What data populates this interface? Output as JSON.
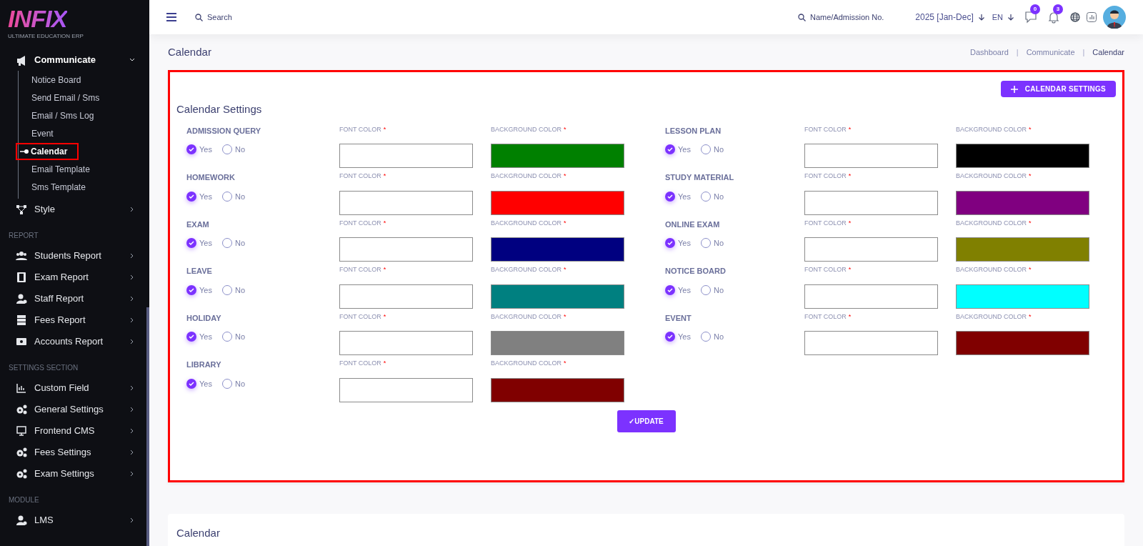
{
  "sidebar": {
    "logo": {
      "name": "INFIX",
      "tagline": "ULTIMATE EDUCATION ERP"
    },
    "sections": [
      {
        "items": [
          {
            "label": "Communicate",
            "expanded": true,
            "children": [
              {
                "label": "Notice Board",
                "selected": false
              },
              {
                "label": "Send Email / Sms",
                "selected": false
              },
              {
                "label": "Email / Sms Log",
                "selected": false
              },
              {
                "label": "Event",
                "selected": false
              },
              {
                "label": "Calendar",
                "selected": true
              },
              {
                "label": "Email Template",
                "selected": false
              },
              {
                "label": "Sms Template",
                "selected": false
              }
            ]
          },
          {
            "label": "Style",
            "expanded": false
          }
        ]
      },
      {
        "heading": "REPORT",
        "items": [
          {
            "label": "Students Report",
            "expanded": false
          },
          {
            "label": "Exam Report",
            "expanded": false
          },
          {
            "label": "Staff Report",
            "expanded": false
          },
          {
            "label": "Fees Report",
            "expanded": false
          },
          {
            "label": "Accounts Report",
            "expanded": false
          }
        ]
      },
      {
        "heading": "SETTINGS SECTION",
        "items": [
          {
            "label": "Custom Field",
            "expanded": false
          },
          {
            "label": "General Settings",
            "expanded": false
          },
          {
            "label": "Frontend CMS",
            "expanded": false
          },
          {
            "label": "Fees Settings",
            "expanded": false
          },
          {
            "label": "Exam Settings",
            "expanded": false
          }
        ]
      },
      {
        "heading": "MODULE",
        "items": [
          {
            "label": "LMS",
            "expanded": false
          }
        ]
      }
    ]
  },
  "header": {
    "search": "Search",
    "student_search": "Name/Admission No.",
    "session": "2025 [Jan-Dec]",
    "language": "EN",
    "message_count": "0",
    "notification_count": "3"
  },
  "page": {
    "title": "Calendar",
    "breadcrumbs": [
      "Dashboard",
      "Communicate",
      "Calendar"
    ],
    "breadcrumb_separators": [
      "|",
      "|"
    ]
  },
  "settings_card": {
    "add_button": "CALENDAR SETTINGS",
    "title": "Calendar Settings",
    "columns": [
      {
        "items": [
          {
            "name": "ADMISSION QUERY",
            "font_label": "FONT COLOR",
            "font_required": "*",
            "background_label": "BACKGROUND COLOR",
            "background_required": "*",
            "color": "#008000",
            "options": [
              {
                "label": "Yes",
                "selected": true
              },
              {
                "label": "No",
                "selected": false
              }
            ]
          },
          {
            "name": "HOMEWORK",
            "font_label": "FONT COLOR",
            "font_required": "*",
            "background_label": "BACKGROUND COLOR",
            "background_required": "*",
            "color": "#ff0000",
            "options": [
              {
                "label": "Yes",
                "selected": true
              },
              {
                "label": "No",
                "selected": false
              }
            ]
          },
          {
            "name": "EXAM",
            "font_label": "FONT COLOR",
            "font_required": "*",
            "background_label": "BACKGROUND COLOR",
            "background_required": "*",
            "color": "#000080",
            "options": [
              {
                "label": "Yes",
                "selected": true
              },
              {
                "label": "No",
                "selected": false
              }
            ]
          },
          {
            "name": "LEAVE",
            "font_label": "FONT COLOR",
            "font_required": "*",
            "background_label": "BACKGROUND COLOR",
            "background_required": "*",
            "color": "#008080",
            "options": [
              {
                "label": "Yes",
                "selected": true
              },
              {
                "label": "No",
                "selected": false
              }
            ]
          },
          {
            "name": "HOLIDAY",
            "font_label": "FONT COLOR",
            "font_required": "*",
            "background_label": "BACKGROUND COLOR",
            "background_required": "*",
            "color": "#808080",
            "options": [
              {
                "label": "Yes",
                "selected": true
              },
              {
                "label": "No",
                "selected": false
              }
            ]
          },
          {
            "name": "LIBRARY",
            "font_label": "FONT COLOR",
            "font_required": "*",
            "background_label": "BACKGROUND COLOR",
            "background_required": "*",
            "color": "#800000",
            "options": [
              {
                "label": "Yes",
                "selected": true
              },
              {
                "label": "No",
                "selected": false
              }
            ]
          }
        ]
      },
      {
        "items": [
          {
            "name": "LESSON PLAN",
            "font_label": "FONT COLOR",
            "font_required": "*",
            "background_label": "BACKGROUND COLOR",
            "background_required": "*",
            "color": "#000000",
            "options": [
              {
                "label": "Yes",
                "selected": true
              },
              {
                "label": "No",
                "selected": false
              }
            ]
          },
          {
            "name": "STUDY MATERIAL",
            "font_label": "FONT COLOR",
            "font_required": "*",
            "background_label": "BACKGROUND COLOR",
            "background_required": "*",
            "color": "#800080",
            "options": [
              {
                "label": "Yes",
                "selected": true
              },
              {
                "label": "No",
                "selected": false
              }
            ]
          },
          {
            "name": "ONLINE EXAM",
            "font_label": "FONT COLOR",
            "font_required": "*",
            "background_label": "BACKGROUND COLOR",
            "background_required": "*",
            "color": "#808000",
            "options": [
              {
                "label": "Yes",
                "selected": true
              },
              {
                "label": "No",
                "selected": false
              }
            ]
          },
          {
            "name": "NOTICE BOARD",
            "font_label": "FONT COLOR",
            "font_required": "*",
            "background_label": "BACKGROUND COLOR",
            "background_required": "*",
            "color": "#00ffff",
            "options": [
              {
                "label": "Yes",
                "selected": true
              },
              {
                "label": "No",
                "selected": false
              }
            ]
          },
          {
            "name": "EVENT",
            "font_label": "FONT COLOR",
            "font_required": "*",
            "background_label": "BACKGROUND COLOR",
            "background_required": "*",
            "color": "#800000",
            "options": [
              {
                "label": "Yes",
                "selected": true
              },
              {
                "label": "No",
                "selected": false
              }
            ]
          }
        ]
      }
    ],
    "update_button": "✓UPDATE"
  },
  "calendar_card": {
    "title": "Calendar"
  }
}
